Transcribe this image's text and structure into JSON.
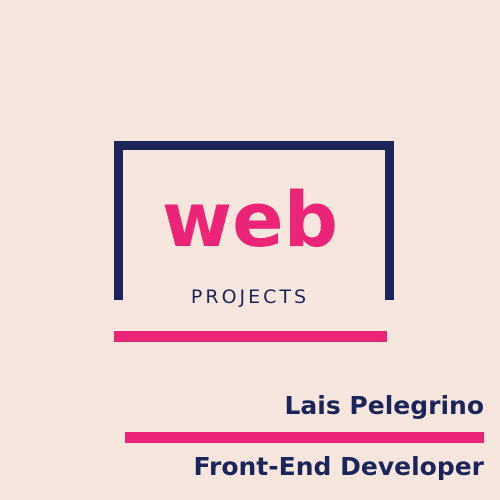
{
  "logo": {
    "main": "web",
    "sub": "PROJECTS"
  },
  "profile": {
    "name": "Lais Pelegrino",
    "role": "Front-End Developer"
  },
  "colors": {
    "background": "#f7e6de",
    "navy": "#1c2559",
    "pink": "#ec2477"
  }
}
